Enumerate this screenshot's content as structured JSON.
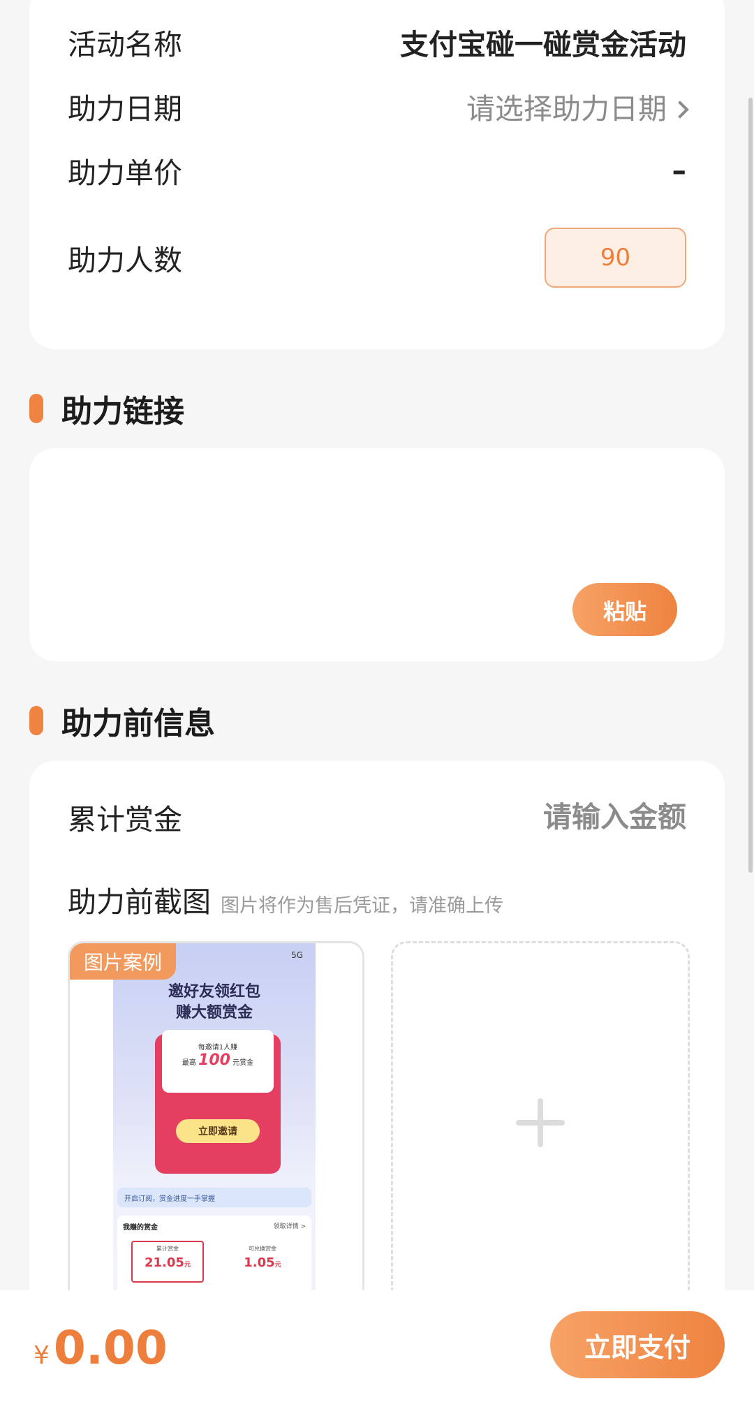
{
  "activity": {
    "name_label": "活动名称",
    "name_value": "支付宝碰一碰赏金活动",
    "date_label": "助力日期",
    "date_placeholder": "请选择助力日期",
    "price_label": "助力单价",
    "price_value": "–",
    "count_label": "助力人数",
    "count_value": "90"
  },
  "link_section": {
    "title": "助力链接",
    "paste_label": "粘贴"
  },
  "before_section": {
    "title": "助力前信息",
    "bounty_label": "累计赏金",
    "bounty_placeholder": "请输入金额",
    "screenshot_label": "助力前截图",
    "screenshot_hint": "图片将作为售后凭证，请准确上传",
    "example_tag": "图片案例",
    "example": {
      "status": "5G",
      "heading_line1": "邀好友领红包",
      "heading_line2": "赚大额赏金",
      "per_invite": "每邀请1人赚",
      "max_prefix": "最高",
      "max_amount": "100",
      "max_suffix": "元赏金",
      "invite_button": "立即邀请",
      "subscribe_text": "开启订阅，赏金进度一手掌握",
      "earn_title": "我赚的赏金",
      "earn_detail": "领取详情 >",
      "total_label": "累计赏金",
      "total_value": "21.05",
      "exchange_label": "可兑换赏金",
      "exchange_value": "1.05",
      "unit": "元"
    }
  },
  "footer": {
    "currency": "¥",
    "amount": "0.00",
    "pay_label": "立即支付"
  },
  "colors": {
    "accent": "#ee8340",
    "background": "#f6f6f6"
  }
}
